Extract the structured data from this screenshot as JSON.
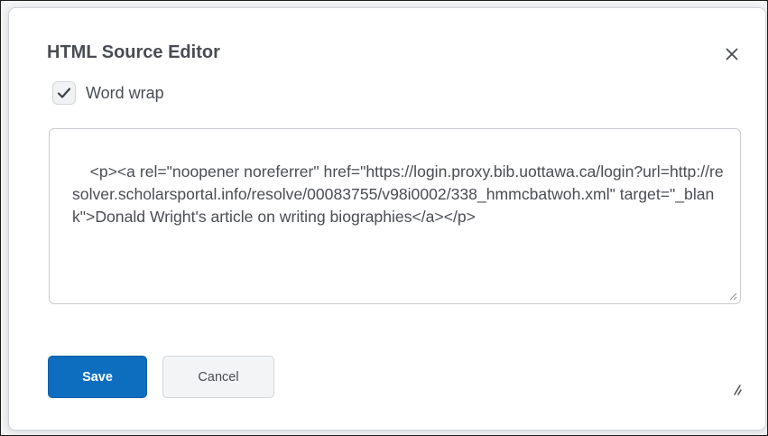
{
  "dialog": {
    "title": "HTML Source Editor",
    "close_icon": "close-icon"
  },
  "word_wrap": {
    "label": "Word wrap",
    "checked": true,
    "check_icon": "checkmark-icon"
  },
  "editor": {
    "source": "<p><a rel=\"noopener noreferrer\" href=\"https://login.proxy.bib.uottawa.ca/login?url=http://resolver.scholarsportal.info/resolve/00083755/v98i0002/338_hmmcbatwoh.xml\" target=\"_blank\">Donald Wright's article on writing biographies</a></p>"
  },
  "actions": {
    "save_label": "Save",
    "cancel_label": "Cancel"
  },
  "colors": {
    "primary": "#0d6ec0",
    "text": "#494c52",
    "border": "#c9ccd1"
  }
}
